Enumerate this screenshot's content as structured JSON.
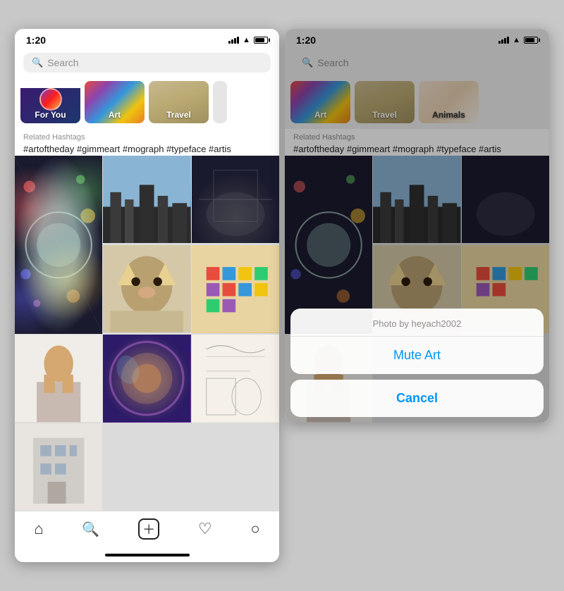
{
  "left_screen": {
    "status": {
      "time": "1:20",
      "time_arrow": "↗"
    },
    "search_placeholder": "Search",
    "categories": [
      {
        "id": "foryou",
        "label": "For You"
      },
      {
        "id": "art",
        "label": "Art"
      },
      {
        "id": "travel",
        "label": "Travel"
      }
    ],
    "hashtags": {
      "label": "Related Hashtags",
      "text": "#artoftheday  #gimmeart  #mograph  #typeface  #artis"
    },
    "nav": {
      "home": "🏠",
      "search": "🔍",
      "add": "➕",
      "heart": "♡",
      "profile": "👤"
    }
  },
  "right_screen": {
    "status": {
      "time": "1:20",
      "time_arrow": "↗"
    },
    "search_placeholder": "Search",
    "categories": [
      {
        "id": "art",
        "label": "Art"
      },
      {
        "id": "travel",
        "label": "Travel"
      },
      {
        "id": "animals",
        "label": "Animals"
      }
    ],
    "hashtags": {
      "label": "Related Hashtags",
      "text": "#artoftheday  #gimmeart  #mograph  #typeface  #artis"
    },
    "action_sheet": {
      "photo_credit": "Photo by heyach2002",
      "mute_button": "Mute Art",
      "cancel_button": "Cancel"
    }
  }
}
